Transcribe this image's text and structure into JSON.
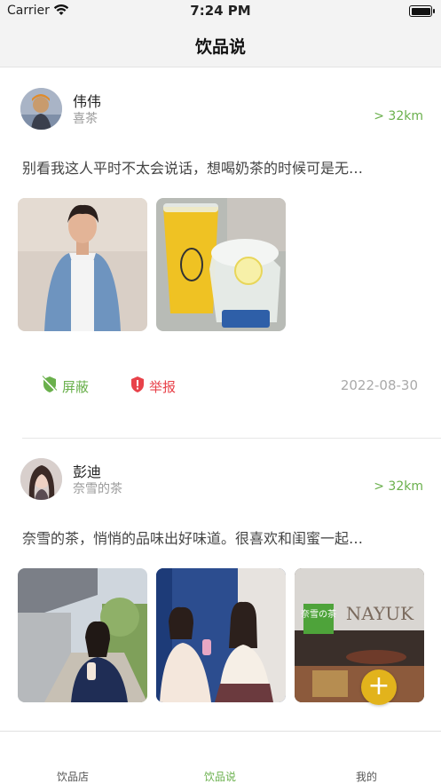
{
  "status_bar": {
    "carrier": "Carrier",
    "time": "7:24 PM"
  },
  "nav": {
    "title": "饮品说"
  },
  "posts": [
    {
      "username": "伟伟",
      "shop": "喜茶",
      "distance": "> 32km",
      "content": "别看我这人平时不太会说话，想喝奶茶的时候可是无…",
      "actions": {
        "block": "屏蔽",
        "report": "举报"
      },
      "date": "2022-08-30"
    },
    {
      "username": "彭迪",
      "shop": "奈雪的茶",
      "distance": "> 32km",
      "content": "奈雪的茶，悄悄的品味出好味道。很喜欢和闺蜜一起…",
      "photo3_sign": {
        "brand_cn": "奈雪の茶",
        "brand_en": "NAYUK"
      }
    }
  ],
  "fab": {
    "label": "+"
  },
  "tabs": [
    {
      "label": "饮品店",
      "active": false
    },
    {
      "label": "饮品说",
      "active": true
    },
    {
      "label": "我的",
      "active": false
    }
  ],
  "colors": {
    "accent": "#6ab04c",
    "report": "#e8424a",
    "fab": "#e2b31c"
  }
}
